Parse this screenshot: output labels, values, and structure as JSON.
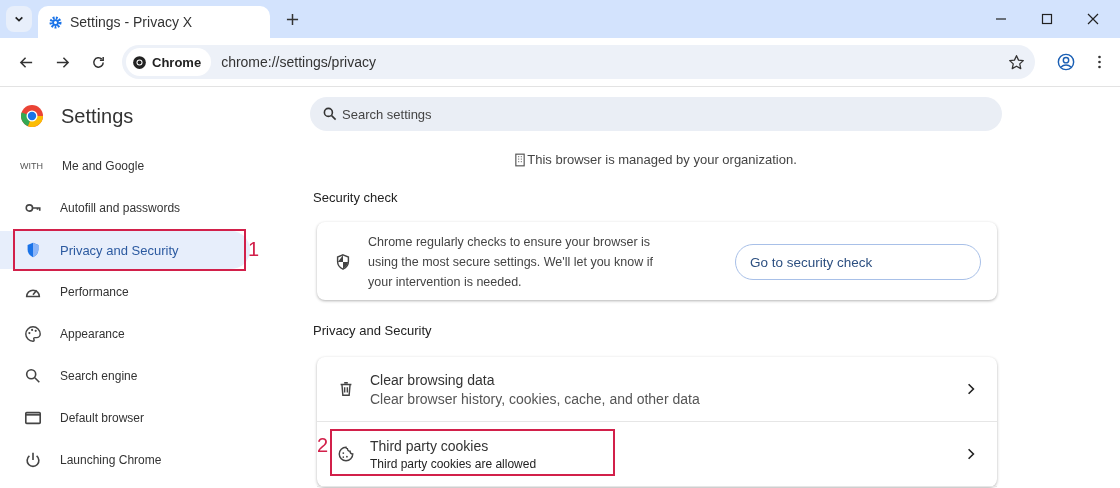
{
  "window": {
    "tab_title": "Settings - Privacy X",
    "address_chip": "Chrome",
    "url": "chrome://settings/privacy"
  },
  "sidebar": {
    "title": "Settings",
    "items": [
      {
        "prefix": "WITH",
        "label": "Me and Google",
        "kind": "plain",
        "selected": false
      },
      {
        "label": "Autofill and passwords",
        "kind": "key",
        "selected": false
      },
      {
        "label": "Privacy and Security",
        "kind": "shield",
        "selected": true,
        "annotation": "1"
      },
      {
        "label": "Performance",
        "kind": "gauge",
        "selected": false
      },
      {
        "label": "Appearance",
        "kind": "palette",
        "selected": false
      },
      {
        "label": "Search engine",
        "kind": "search",
        "selected": false
      },
      {
        "label": "Default browser",
        "kind": "window",
        "selected": false
      },
      {
        "label": "Launching Chrome",
        "kind": "power",
        "selected": false
      }
    ]
  },
  "search": {
    "placeholder": "Search settings"
  },
  "managed_notice": "This browser is managed by your organization.",
  "security_check": {
    "heading": "Security check",
    "text": "Chrome regularly checks to ensure your browser is using the most secure settings. We'll let you know if your intervention is needed.",
    "button": "Go to security check"
  },
  "privacy": {
    "heading": "Privacy and Security",
    "rows": [
      {
        "title": "Clear browsing data",
        "subtitle": "Clear browser history, cookies, cache, and other data",
        "kind": "trash"
      },
      {
        "title": "Third party cookies",
        "subtitle": "Third party cookies are allowed",
        "kind": "cookie",
        "annotation": "2"
      }
    ]
  }
}
